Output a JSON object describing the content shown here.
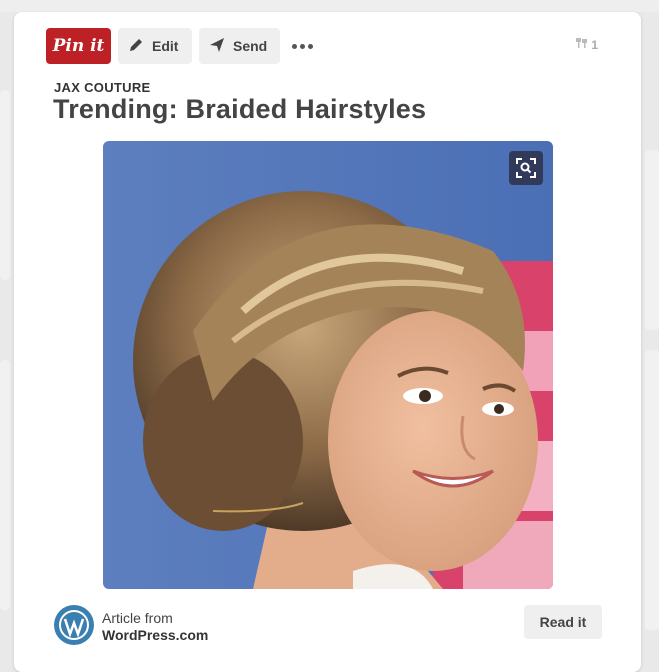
{
  "toolbar": {
    "pin_label": "Pin it",
    "edit_label": "Edit",
    "send_label": "Send",
    "repin_count": "1"
  },
  "pin": {
    "source": "JAX COUTURE",
    "title": "Trending: Braided Hairstyles"
  },
  "footer": {
    "article_from": "Article from",
    "domain": "WordPress.com",
    "read_label": "Read it"
  },
  "colors": {
    "pin_red": "#bd2126",
    "wordpress_blue": "#3a7fb0"
  }
}
